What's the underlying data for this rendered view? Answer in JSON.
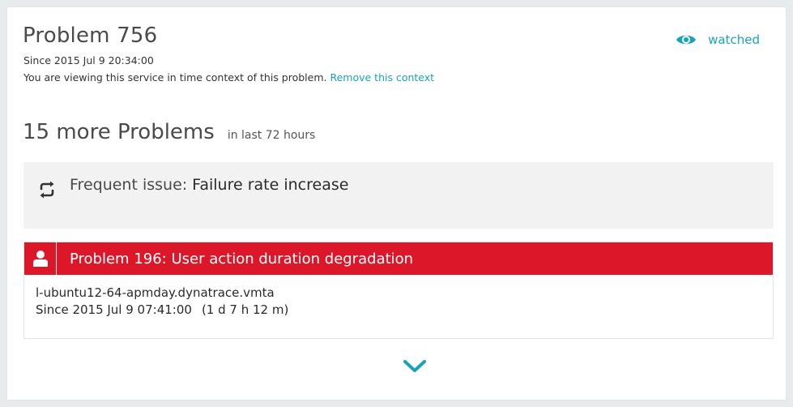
{
  "header": {
    "title": "Problem 756",
    "since": "Since 2015 Jul 9 20:34:00",
    "context_text": "You are viewing this service in time context of this problem.",
    "context_link": "Remove this context",
    "watched_label": "watched",
    "watched_icon": "eye-icon"
  },
  "more": {
    "title": "15 more Problems",
    "subtitle": "in last 72 hours"
  },
  "frequent": {
    "icon": "repeat-icon",
    "label": "Frequent issue:",
    "value": "Failure rate increase"
  },
  "problem": {
    "icon": "user-icon",
    "title": "Problem 196: User action duration degradation",
    "host": "l-ubuntu12-64-apmday.dynatrace.vmta",
    "since": "Since 2015 Jul 9 07:41:00",
    "duration": "(1 d 7 h 12 m)"
  },
  "expand": {
    "icon": "chevron-down-icon"
  },
  "colors": {
    "accent": "#1aa3b8",
    "problem_red": "#dc172a",
    "frequent_bg": "#f2f2f2"
  }
}
